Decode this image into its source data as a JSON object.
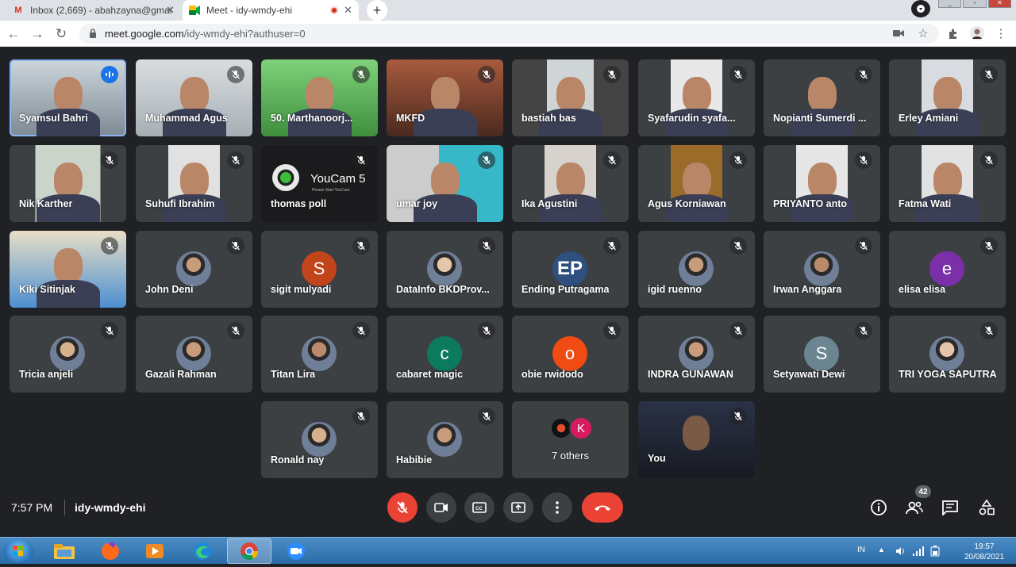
{
  "browser": {
    "tabs": [
      {
        "title": "Inbox (2,669) - abahzayna@gmai",
        "icon": "gmail-icon"
      },
      {
        "title": "Meet - idy-wmdy-ehi",
        "icon": "meet-icon"
      }
    ],
    "url_host": "meet.google.com",
    "url_path": "/idy-wmdy-ehi?authuser=0"
  },
  "participants": [
    {
      "name": "Syamsul Bahri",
      "speaking": true
    },
    {
      "name": "Muhammad Agus"
    },
    {
      "name": "50. Marthanoorj..."
    },
    {
      "name": "MKFD"
    },
    {
      "name": "bastiah bas"
    },
    {
      "name": "Syafarudin syafa..."
    },
    {
      "name": "Nopianti Sumerdi ..."
    },
    {
      "name": "Erley Amiani"
    },
    {
      "name": "Nik Karther"
    },
    {
      "name": "Suhufi Ibrahim"
    },
    {
      "name": "thomas poll",
      "overlay_title": "YouCam 5",
      "overlay_sub": "Please Start YouCam"
    },
    {
      "name": "umar joy"
    },
    {
      "name": "Ika Agustini"
    },
    {
      "name": "Agus Korniawan"
    },
    {
      "name": "PRIYANTO anto"
    },
    {
      "name": "Fatma Wati"
    },
    {
      "name": "Kiki Sitinjak"
    },
    {
      "name": "John Deni"
    },
    {
      "name": "sigit mulyadi",
      "initial": "S",
      "color": "#c1441b"
    },
    {
      "name": "DataInfo BKDProv..."
    },
    {
      "name": "Ending Putragama",
      "initial": "EP",
      "color": "#2f4f7f"
    },
    {
      "name": "igid ruenno"
    },
    {
      "name": "Irwan Anggara"
    },
    {
      "name": "elisa elisa",
      "initial": "e",
      "color": "#7b2fa8"
    },
    {
      "name": "Tricia anjeli"
    },
    {
      "name": "Gazali Rahman"
    },
    {
      "name": "Titan Lira"
    },
    {
      "name": "cabaret magic",
      "initial": "c",
      "color": "#0b7a5e"
    },
    {
      "name": "obie rwidodo",
      "initial": "o",
      "color": "#f04b12"
    },
    {
      "name": "INDRA GUNAWAN"
    },
    {
      "name": "Setyawati Dewi",
      "initial": "S",
      "color": "#6b8591"
    },
    {
      "name": "TRI YOGA SAPUTRA"
    },
    {
      "name": "Ronald nay"
    },
    {
      "name": "Habibie"
    },
    {
      "name": "7 others",
      "initial_b": "K"
    },
    {
      "name": "You"
    }
  ],
  "meeting": {
    "time": "7:57 PM",
    "code": "idy-wmdy-ehi",
    "participant_count": "42"
  },
  "taskbar": {
    "lang": "IN",
    "time": "19:57",
    "date": "20/08/2021"
  }
}
